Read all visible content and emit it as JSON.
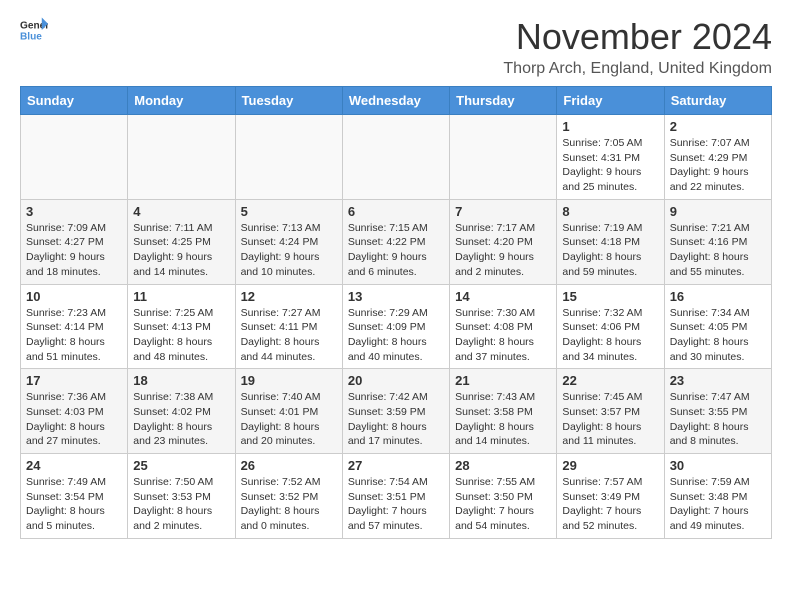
{
  "header": {
    "logo_general": "General",
    "logo_blue": "Blue",
    "title": "November 2024",
    "location": "Thorp Arch, England, United Kingdom"
  },
  "weekdays": [
    "Sunday",
    "Monday",
    "Tuesday",
    "Wednesday",
    "Thursday",
    "Friday",
    "Saturday"
  ],
  "weeks": [
    [
      {
        "day": "",
        "detail": ""
      },
      {
        "day": "",
        "detail": ""
      },
      {
        "day": "",
        "detail": ""
      },
      {
        "day": "",
        "detail": ""
      },
      {
        "day": "",
        "detail": ""
      },
      {
        "day": "1",
        "detail": "Sunrise: 7:05 AM\nSunset: 4:31 PM\nDaylight: 9 hours and 25 minutes."
      },
      {
        "day": "2",
        "detail": "Sunrise: 7:07 AM\nSunset: 4:29 PM\nDaylight: 9 hours and 22 minutes."
      }
    ],
    [
      {
        "day": "3",
        "detail": "Sunrise: 7:09 AM\nSunset: 4:27 PM\nDaylight: 9 hours and 18 minutes."
      },
      {
        "day": "4",
        "detail": "Sunrise: 7:11 AM\nSunset: 4:25 PM\nDaylight: 9 hours and 14 minutes."
      },
      {
        "day": "5",
        "detail": "Sunrise: 7:13 AM\nSunset: 4:24 PM\nDaylight: 9 hours and 10 minutes."
      },
      {
        "day": "6",
        "detail": "Sunrise: 7:15 AM\nSunset: 4:22 PM\nDaylight: 9 hours and 6 minutes."
      },
      {
        "day": "7",
        "detail": "Sunrise: 7:17 AM\nSunset: 4:20 PM\nDaylight: 9 hours and 2 minutes."
      },
      {
        "day": "8",
        "detail": "Sunrise: 7:19 AM\nSunset: 4:18 PM\nDaylight: 8 hours and 59 minutes."
      },
      {
        "day": "9",
        "detail": "Sunrise: 7:21 AM\nSunset: 4:16 PM\nDaylight: 8 hours and 55 minutes."
      }
    ],
    [
      {
        "day": "10",
        "detail": "Sunrise: 7:23 AM\nSunset: 4:14 PM\nDaylight: 8 hours and 51 minutes."
      },
      {
        "day": "11",
        "detail": "Sunrise: 7:25 AM\nSunset: 4:13 PM\nDaylight: 8 hours and 48 minutes."
      },
      {
        "day": "12",
        "detail": "Sunrise: 7:27 AM\nSunset: 4:11 PM\nDaylight: 8 hours and 44 minutes."
      },
      {
        "day": "13",
        "detail": "Sunrise: 7:29 AM\nSunset: 4:09 PM\nDaylight: 8 hours and 40 minutes."
      },
      {
        "day": "14",
        "detail": "Sunrise: 7:30 AM\nSunset: 4:08 PM\nDaylight: 8 hours and 37 minutes."
      },
      {
        "day": "15",
        "detail": "Sunrise: 7:32 AM\nSunset: 4:06 PM\nDaylight: 8 hours and 34 minutes."
      },
      {
        "day": "16",
        "detail": "Sunrise: 7:34 AM\nSunset: 4:05 PM\nDaylight: 8 hours and 30 minutes."
      }
    ],
    [
      {
        "day": "17",
        "detail": "Sunrise: 7:36 AM\nSunset: 4:03 PM\nDaylight: 8 hours and 27 minutes."
      },
      {
        "day": "18",
        "detail": "Sunrise: 7:38 AM\nSunset: 4:02 PM\nDaylight: 8 hours and 23 minutes."
      },
      {
        "day": "19",
        "detail": "Sunrise: 7:40 AM\nSunset: 4:01 PM\nDaylight: 8 hours and 20 minutes."
      },
      {
        "day": "20",
        "detail": "Sunrise: 7:42 AM\nSunset: 3:59 PM\nDaylight: 8 hours and 17 minutes."
      },
      {
        "day": "21",
        "detail": "Sunrise: 7:43 AM\nSunset: 3:58 PM\nDaylight: 8 hours and 14 minutes."
      },
      {
        "day": "22",
        "detail": "Sunrise: 7:45 AM\nSunset: 3:57 PM\nDaylight: 8 hours and 11 minutes."
      },
      {
        "day": "23",
        "detail": "Sunrise: 7:47 AM\nSunset: 3:55 PM\nDaylight: 8 hours and 8 minutes."
      }
    ],
    [
      {
        "day": "24",
        "detail": "Sunrise: 7:49 AM\nSunset: 3:54 PM\nDaylight: 8 hours and 5 minutes."
      },
      {
        "day": "25",
        "detail": "Sunrise: 7:50 AM\nSunset: 3:53 PM\nDaylight: 8 hours and 2 minutes."
      },
      {
        "day": "26",
        "detail": "Sunrise: 7:52 AM\nSunset: 3:52 PM\nDaylight: 8 hours and 0 minutes."
      },
      {
        "day": "27",
        "detail": "Sunrise: 7:54 AM\nSunset: 3:51 PM\nDaylight: 7 hours and 57 minutes."
      },
      {
        "day": "28",
        "detail": "Sunrise: 7:55 AM\nSunset: 3:50 PM\nDaylight: 7 hours and 54 minutes."
      },
      {
        "day": "29",
        "detail": "Sunrise: 7:57 AM\nSunset: 3:49 PM\nDaylight: 7 hours and 52 minutes."
      },
      {
        "day": "30",
        "detail": "Sunrise: 7:59 AM\nSunset: 3:48 PM\nDaylight: 7 hours and 49 minutes."
      }
    ]
  ]
}
